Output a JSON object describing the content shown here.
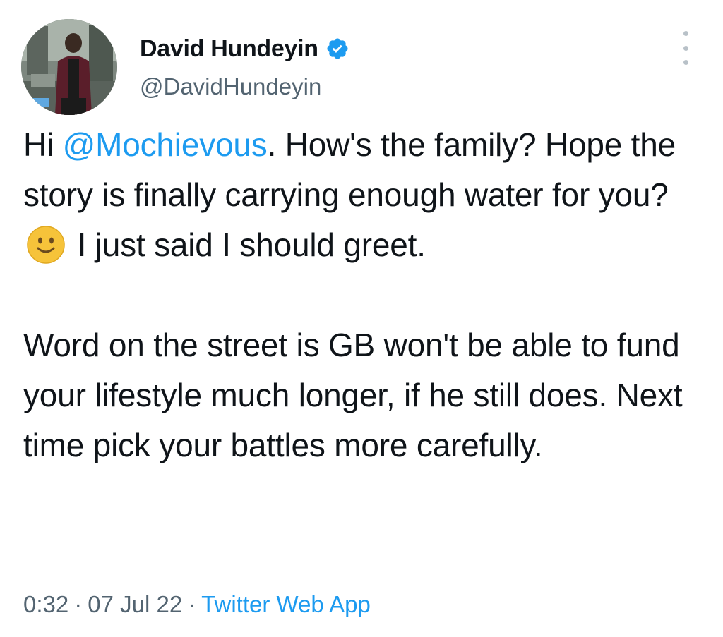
{
  "author": {
    "display_name": "David Hundeyin",
    "handle": "@DavidHundeyin",
    "verified_icon": "verified-badge-icon"
  },
  "tweet": {
    "para1": {
      "pre": "Hi ",
      "mention": "@Mochievous",
      "after_mention": ". How's the family? Hope the story is finally carrying enough water for you?",
      "emoji": "slightly-smiling-face-emoji",
      "after_emoji": " I just said I should greet."
    },
    "para2": "Word on the street is GB won't be able to fund your lifestyle much longer, if he still does. Next time pick your battles more carefully."
  },
  "meta": {
    "time": "0:32",
    "separator": "·",
    "date": "07 Jul 22",
    "source": "Twitter Web App"
  },
  "colors": {
    "link": "#1d9bf0",
    "secondary_text": "#536471",
    "primary_text": "#0f1419",
    "verified": "#1d9bf0"
  }
}
